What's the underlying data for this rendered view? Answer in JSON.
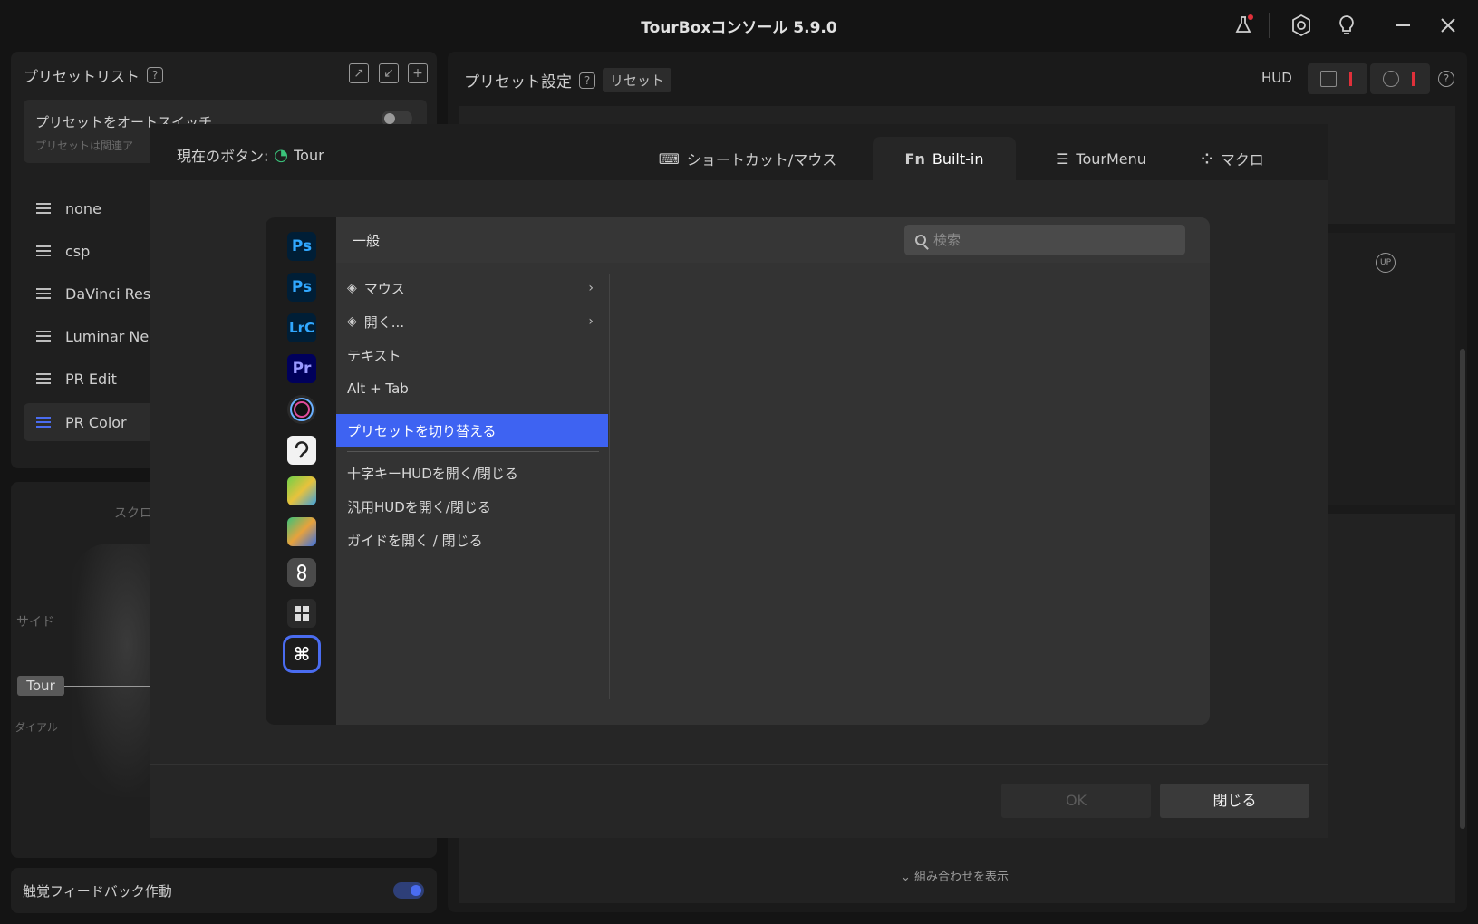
{
  "app": {
    "title": "TourBoxコンソール 5.9.0"
  },
  "left": {
    "preset_list_title": "プリセットリスト",
    "auto_switch_title": "プリセットをオートスイッチ",
    "auto_switch_sub": "プリセットは関連ア",
    "presets": [
      "none",
      "csp",
      "DaVinci Reso",
      "Luminar Neo",
      "PR Edit",
      "PR Color"
    ],
    "active_preset": "PR Color",
    "device_labels": {
      "scroll": "スクロ",
      "side": "サイド",
      "tour": "Tour",
      "dial": "ダイアル"
    },
    "haptic": "触覚フィードバック作動"
  },
  "right": {
    "title": "プリセット設定",
    "reset": "リセット",
    "hud": "HUD",
    "show_combos": "組み合わせを表示",
    "up_badge": "UP"
  },
  "modal": {
    "current_button_label": "現在のボタン:",
    "current_button_value": "Tour",
    "tabs": [
      {
        "label": "ショートカット/マウス",
        "icon": "keyboard-mouse-icon"
      },
      {
        "label": "Built-in",
        "icon": "fn-icon",
        "icon_text": "Fn"
      },
      {
        "label": "TourMenu",
        "icon": "menu-icon"
      },
      {
        "label": "マクロ",
        "icon": "macro-icon"
      }
    ],
    "active_tab": "Built-in",
    "category_title": "一般",
    "search_placeholder": "検索",
    "functions": [
      {
        "label": "マウス",
        "submenu": true
      },
      {
        "label": "開く...",
        "submenu": true
      },
      {
        "label": "テキスト",
        "submenu": false
      },
      {
        "label": "Alt + Tab",
        "submenu": false
      },
      {
        "label": "プリセットを切り替える",
        "submenu": false
      },
      {
        "label": "十字キーHUDを開く/閉じる",
        "submenu": false
      },
      {
        "label": "汎用HUDを開く/閉じる",
        "submenu": false
      },
      {
        "label": "ガイドを開く / 閉じる",
        "submenu": false
      }
    ],
    "selected_function": "プリセットを切り替える",
    "apps": [
      {
        "text": "Ps",
        "color": "#31a8ff",
        "bg": "#001e36"
      },
      {
        "text": "Ps",
        "color": "#31a8ff",
        "bg": "#001e36"
      },
      {
        "text": "LrC",
        "color": "#31a8ff",
        "bg": "#001e36"
      },
      {
        "text": "Pr",
        "color": "#9999ff",
        "bg": "#00005b"
      }
    ],
    "ok": "OK",
    "close": "閉じる"
  }
}
